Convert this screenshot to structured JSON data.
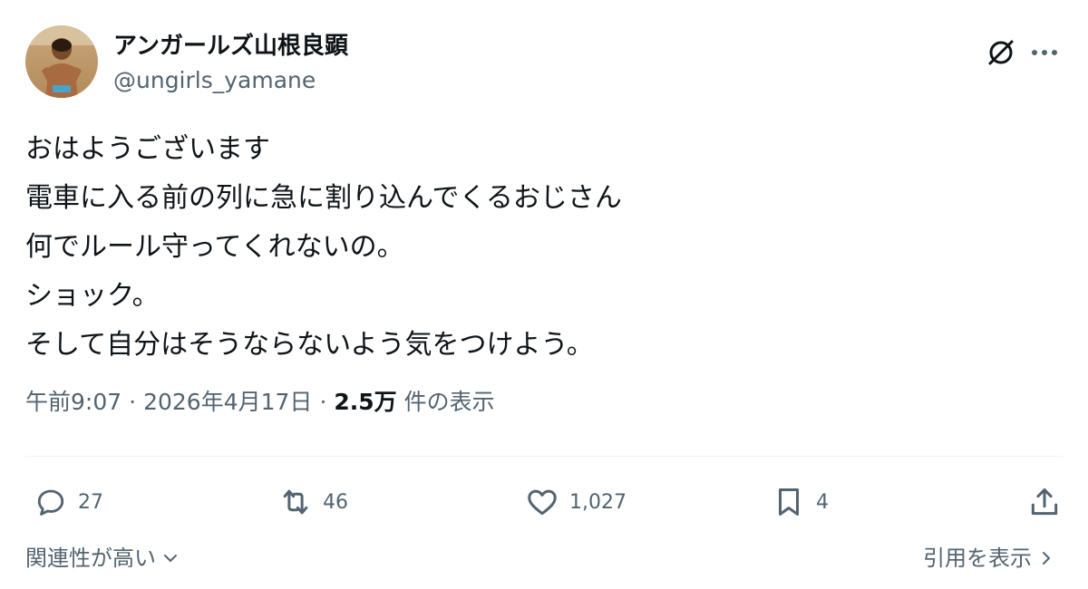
{
  "author": {
    "display_name": "アンガールズ山根良顕",
    "handle": "@ungirls_yamane",
    "avatar_icon": "avatar-photo"
  },
  "header_icons": {
    "grok": "grok-icon",
    "more": "more-dots-icon"
  },
  "tweet": {
    "lines": [
      "おはようございます",
      "電車に入る前の列に急に割り込んでくるおじさん",
      "何でルール守ってくれないの。",
      "ショック。",
      "そして自分はそうならないよう気をつけよう。"
    ]
  },
  "meta": {
    "time": "午前9:07",
    "separator": "·",
    "date": "2026年4月17日",
    "views_count": "2.5万",
    "views_label": "件の表示"
  },
  "actions": {
    "reply_count": "27",
    "repost_count": "46",
    "like_count": "1,027",
    "bookmark_count": "4"
  },
  "footer": {
    "sort_label": "関連性が高い",
    "quotes_label": "引用を表示"
  },
  "colors": {
    "text": "#0f1419",
    "secondary": "#536471",
    "divider": "#eff3f4"
  }
}
